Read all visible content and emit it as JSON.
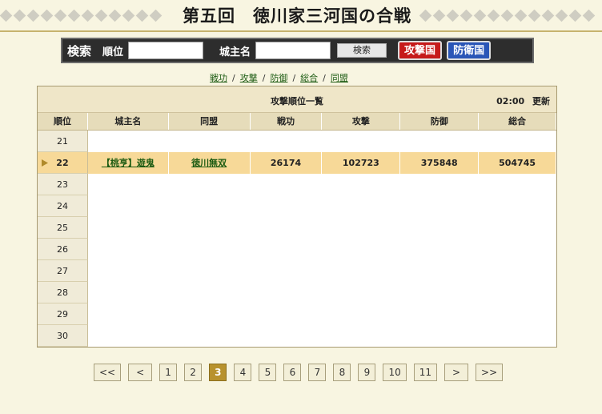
{
  "header": {
    "title": "第五回　徳川家三河国の合戦"
  },
  "search": {
    "title": "検索",
    "rank_label": "順位",
    "rank_value": "",
    "lord_label": "城主名",
    "lord_value": "",
    "search_button": "検索",
    "attack_country": "攻撃国",
    "defense_country": "防衛国"
  },
  "nav": {
    "links": [
      "戦功",
      "攻撃",
      "防御",
      "総合",
      "同盟"
    ]
  },
  "table": {
    "title": "攻撃順位一覧",
    "time": "02:00",
    "update_label": "更新",
    "columns": [
      "順位",
      "城主名",
      "同盟",
      "戦功",
      "攻撃",
      "防御",
      "総合"
    ],
    "ranks": [
      "21",
      "22",
      "23",
      "24",
      "25",
      "26",
      "27",
      "28",
      "29",
      "30"
    ],
    "highlight": {
      "rank": "22",
      "name": "【桃亨】遊鬼",
      "alliance": "徳川無双",
      "senko": "26174",
      "attack": "102723",
      "defense": "375848",
      "total": "504745"
    }
  },
  "pager": {
    "first": "<<",
    "prev": "<",
    "pages": [
      "1",
      "2",
      "3",
      "4",
      "5",
      "6",
      "7",
      "8",
      "9",
      "10",
      "11"
    ],
    "current": "3",
    "next": ">",
    "last": ">>"
  },
  "colors": {
    "accent": "#b8922e",
    "highlight_row": "#f7d998",
    "attack": "#c61a1a",
    "defense": "#2a56b7"
  }
}
